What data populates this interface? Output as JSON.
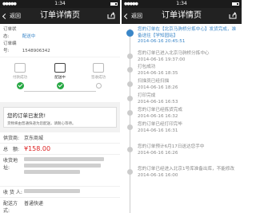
{
  "statusbar": {
    "time": "1:34"
  },
  "left": {
    "nav": {
      "back": "返回",
      "title": "订单详情页"
    },
    "order": {
      "status_label": "订单状态:",
      "status_value": "配送中",
      "number_label": "订单编号:",
      "number_value": "1548906342"
    },
    "steps": [
      {
        "label": "付款成功",
        "done": true
      },
      {
        "label": "配送中",
        "done": true
      },
      {
        "label": "签收成功",
        "done": false
      }
    ],
    "message": {
      "title": "您的订单已发货!",
      "sub": "货物将由普通快递为您配送，请耐心等待。"
    },
    "info": {
      "supplier_label": "供货商:",
      "supplier_value": "京东商城",
      "amount_label": "总　额:",
      "amount_value": "¥158.00",
      "address_label": "收货地址:",
      "receiver_label": "收 货 人:",
      "shipping_label": "配送方式:",
      "shipping_value": "普通快递"
    }
  },
  "right": {
    "nav": {
      "back": "返回",
      "title": "订单详情页"
    },
    "events": [
      {
        "text": "您的订单在【北京马驹桥分拣中心】发货完成，准备送往【学知园站】",
        "time": "2014-06-16 20:45:51"
      },
      {
        "text": "您的订单已进入北京马驹桥分拣中心",
        "time": "2014-06-16 19:37:00"
      },
      {
        "text": "打包成功",
        "time": "2014-06-16 18:35"
      },
      {
        "text": "扫描员已经扫描",
        "time": "2014-06-16 18:26"
      },
      {
        "text": "打印完成",
        "time": "2014-06-16 16:53"
      },
      {
        "text": "您的订单已经拣货完成",
        "time": "2014-06-16 16:32"
      },
      {
        "text": "您的订单已经打印完毕",
        "time": "2014-06-16 16:31"
      },
      {
        "text": "您的订单预计6月17日送达您手中",
        "time": "2014-06-16 16:26"
      },
      {
        "text": "您的订单已经进入北京1号库准备出库，不能修改",
        "time": "2014-06-16 16:00"
      }
    ]
  }
}
